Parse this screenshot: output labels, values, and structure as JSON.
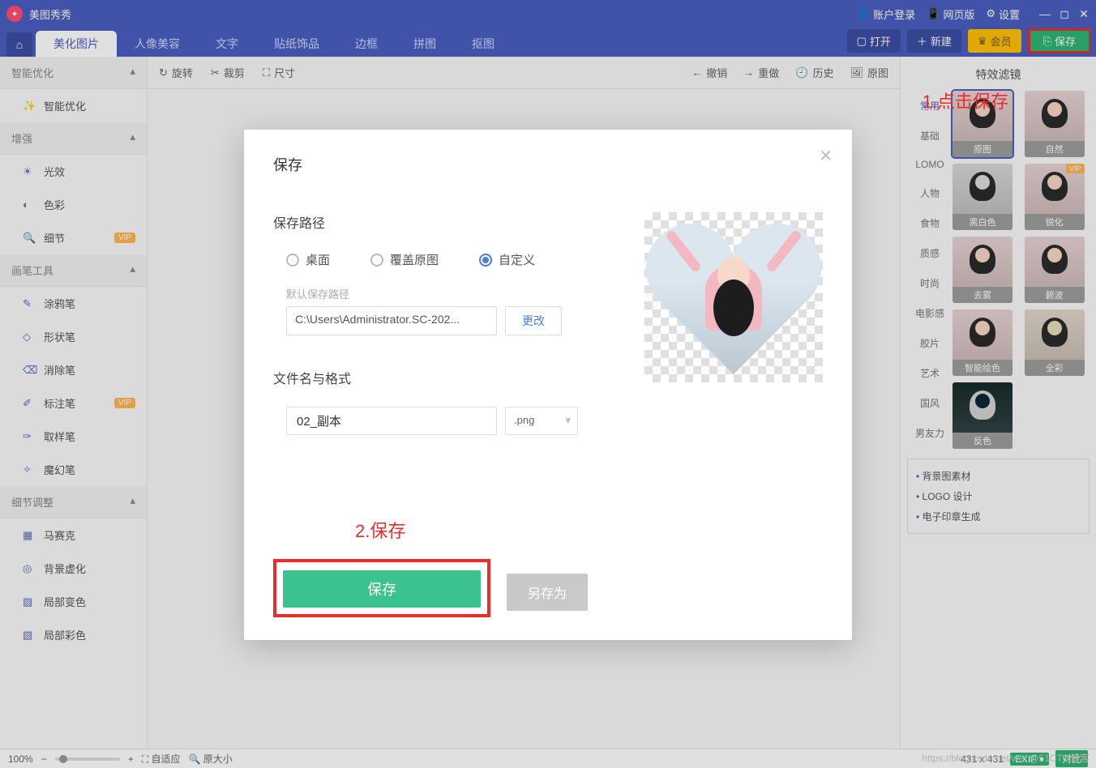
{
  "app": {
    "name": "美图秀秀"
  },
  "titlebar": {
    "account": "账户登录",
    "web": "网页版",
    "settings": "设置"
  },
  "nav": {
    "tabs": [
      "美化图片",
      "人像美容",
      "文字",
      "贴纸饰品",
      "边框",
      "拼图",
      "抠图"
    ],
    "open": "打开",
    "new": "新建",
    "vip": "会员",
    "save": "保存"
  },
  "sidebar": {
    "groups": [
      {
        "title": "智能优化",
        "items": [
          {
            "label": "智能优化"
          }
        ]
      },
      {
        "title": "增强",
        "items": [
          {
            "label": "光效"
          },
          {
            "label": "色彩"
          },
          {
            "label": "细节",
            "vip": true
          }
        ]
      },
      {
        "title": "画笔工具",
        "items": [
          {
            "label": "涂鸦笔"
          },
          {
            "label": "形状笔"
          },
          {
            "label": "消除笔"
          },
          {
            "label": "标注笔",
            "vip": true
          },
          {
            "label": "取样笔"
          },
          {
            "label": "魔幻笔"
          }
        ]
      },
      {
        "title": "细节调整",
        "items": [
          {
            "label": "马赛克"
          },
          {
            "label": "背景虚化"
          },
          {
            "label": "局部变色"
          },
          {
            "label": "局部彩色"
          }
        ]
      }
    ],
    "vip_tag": "VIP"
  },
  "toolbar": {
    "rotate": "旋转",
    "crop": "裁剪",
    "size": "尺寸",
    "undo": "撤销",
    "redo": "重做",
    "history": "历史",
    "original": "原图"
  },
  "right_panel": {
    "title": "特效滤镜",
    "cats": [
      "常用",
      "基础",
      "LOMO",
      "人物",
      "食物",
      "质感",
      "时尚",
      "电影感",
      "胶片",
      "艺术",
      "国风",
      "男友力"
    ],
    "thumbs": [
      "原图",
      "自然",
      "黑白色",
      "锐化",
      "去雾",
      "碧波",
      "智能绘色",
      "全彩",
      "反色"
    ],
    "vip_tag": "VIP",
    "links": [
      "背景图素材",
      "LOGO 设计",
      "电子印章生成"
    ]
  },
  "statusbar": {
    "zoom": "100%",
    "fit": "自适应",
    "orig_size": "原大小",
    "dims": "431 x 431",
    "exif": "EXIF",
    "compare": "对比"
  },
  "dialog": {
    "title": "保存",
    "path_section": "保存路径",
    "radio_desktop": "桌面",
    "radio_overwrite": "覆盖原图",
    "radio_custom": "自定义",
    "path_label": "默认保存路径",
    "path_value": "C:\\Users\\Administrator.SC-202...",
    "change": "更改",
    "name_section": "文件名与格式",
    "name_value": "02_副本",
    "format": ".png",
    "save": "保存",
    "save_as": "另存为"
  },
  "annotations": {
    "a1": "1.点击保存",
    "a2": "2.保存"
  },
  "watermark": "https://blog.csdn.net/wei  @51CTO博客"
}
